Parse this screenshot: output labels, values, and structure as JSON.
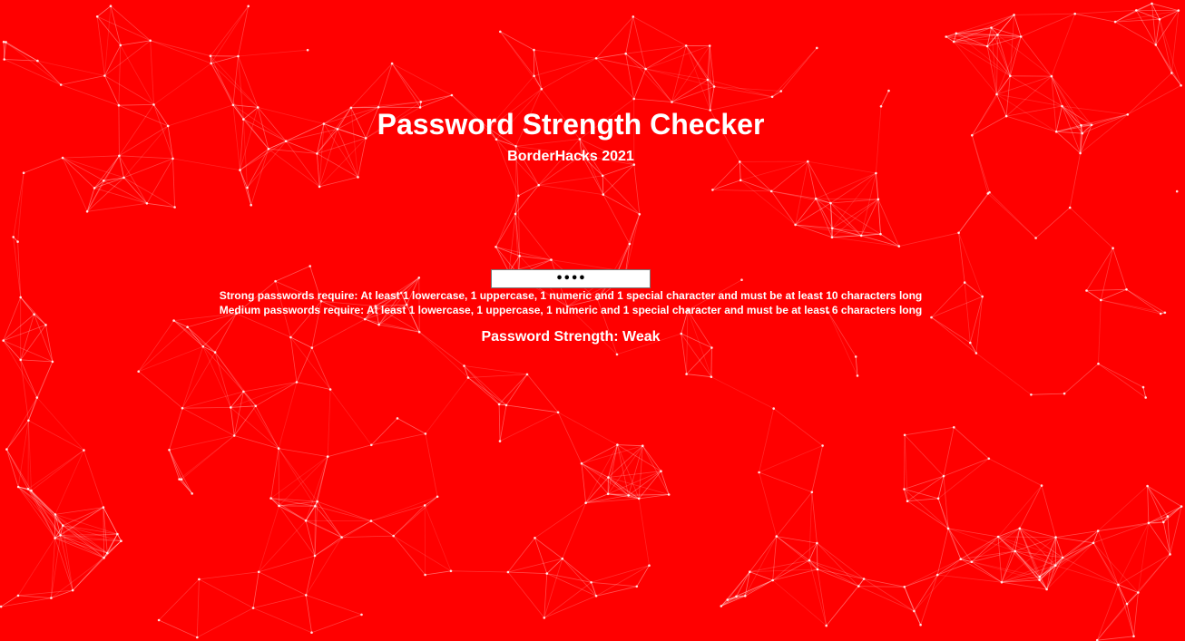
{
  "theme": {
    "background_color": "#ff0000",
    "text_color": "#ffffff",
    "network_line_color": "#ffffff"
  },
  "header": {
    "title": "Password Strength Checker",
    "subtitle": "BorderHacks 2021"
  },
  "password_field": {
    "value": "1234"
  },
  "requirements": {
    "strong": "Strong passwords require: At least 1 lowercase, 1 uppercase, 1 numeric and 1 special character and must be at least 10 characters long",
    "medium": "Medium passwords require: At least 1 lowercase, 1 uppercase, 1 numeric and 1 special character and must be at least 6 characters long"
  },
  "result": {
    "strength_text": "Password Strength: Weak"
  }
}
